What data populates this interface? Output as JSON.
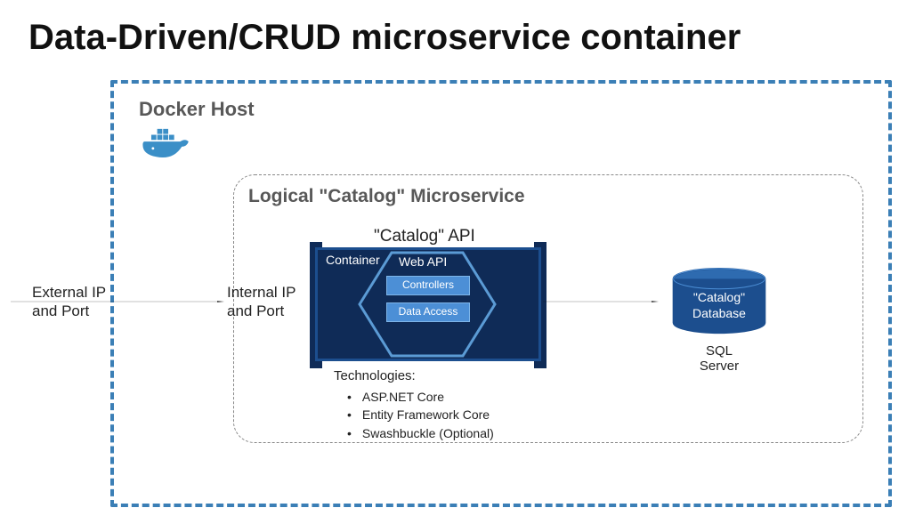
{
  "title": "Data-Driven/CRUD microservice container",
  "dockerHost": {
    "label": "Docker Host"
  },
  "logical": {
    "label": "Logical \"Catalog\" Microservice"
  },
  "external": {
    "line1": "External IP",
    "line2": "and Port"
  },
  "internal": {
    "line1": "Internal IP",
    "line2": "and Port"
  },
  "catalogApi": {
    "label": "\"Catalog\" API"
  },
  "container": {
    "label": "Container",
    "webapi": "Web API",
    "controllers": "Controllers",
    "dataAccess": "Data Access"
  },
  "technologies": {
    "heading": "Technologies:",
    "items": [
      "ASP.NET Core",
      "Entity Framework Core",
      "Swashbuckle (Optional)"
    ]
  },
  "database": {
    "line1": "\"Catalog\"",
    "line2": "Database",
    "engine": "SQL Server"
  }
}
